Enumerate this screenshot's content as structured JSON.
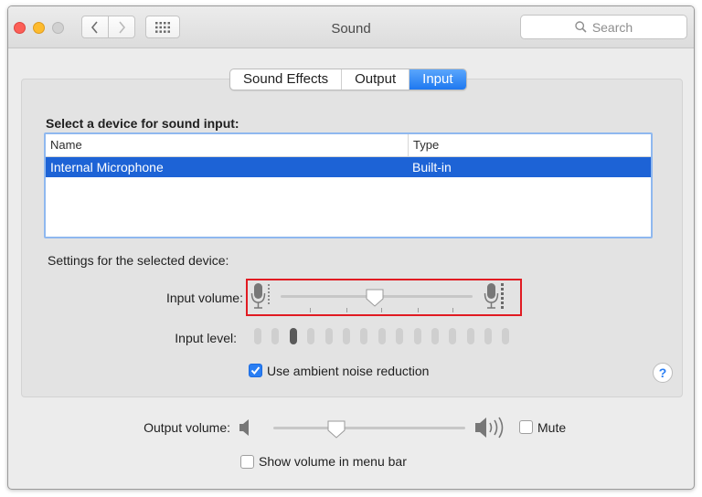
{
  "window": {
    "title": "Sound"
  },
  "search": {
    "placeholder": "Search"
  },
  "tabs": [
    {
      "label": "Sound Effects",
      "active": false
    },
    {
      "label": "Output",
      "active": false
    },
    {
      "label": "Input",
      "active": true
    }
  ],
  "input": {
    "section_title": "Select a device for sound input:",
    "table": {
      "columns": [
        "Name",
        "Type"
      ],
      "rows": [
        {
          "name": "Internal Microphone",
          "type": "Built-in",
          "selected": true
        }
      ]
    },
    "settings_label": "Settings for the selected device:",
    "input_volume_label": "Input volume:",
    "input_volume_level": 0.49,
    "input_level_label": "Input level:",
    "input_level_active_cells": 1,
    "input_level_total_cells": 15,
    "ambient_noise_label": "Use ambient noise reduction",
    "ambient_noise_checked": true
  },
  "output": {
    "volume_label": "Output volume:",
    "volume_level": 0.33,
    "mute_label": "Mute",
    "mute_checked": false,
    "show_in_menu_label": "Show volume in menu bar",
    "show_in_menu_checked": false
  },
  "help": {
    "label": "?"
  },
  "colors": {
    "accent": "#2a7ef3",
    "selection": "#1d63d6",
    "highlight_box": "#e11b22"
  }
}
